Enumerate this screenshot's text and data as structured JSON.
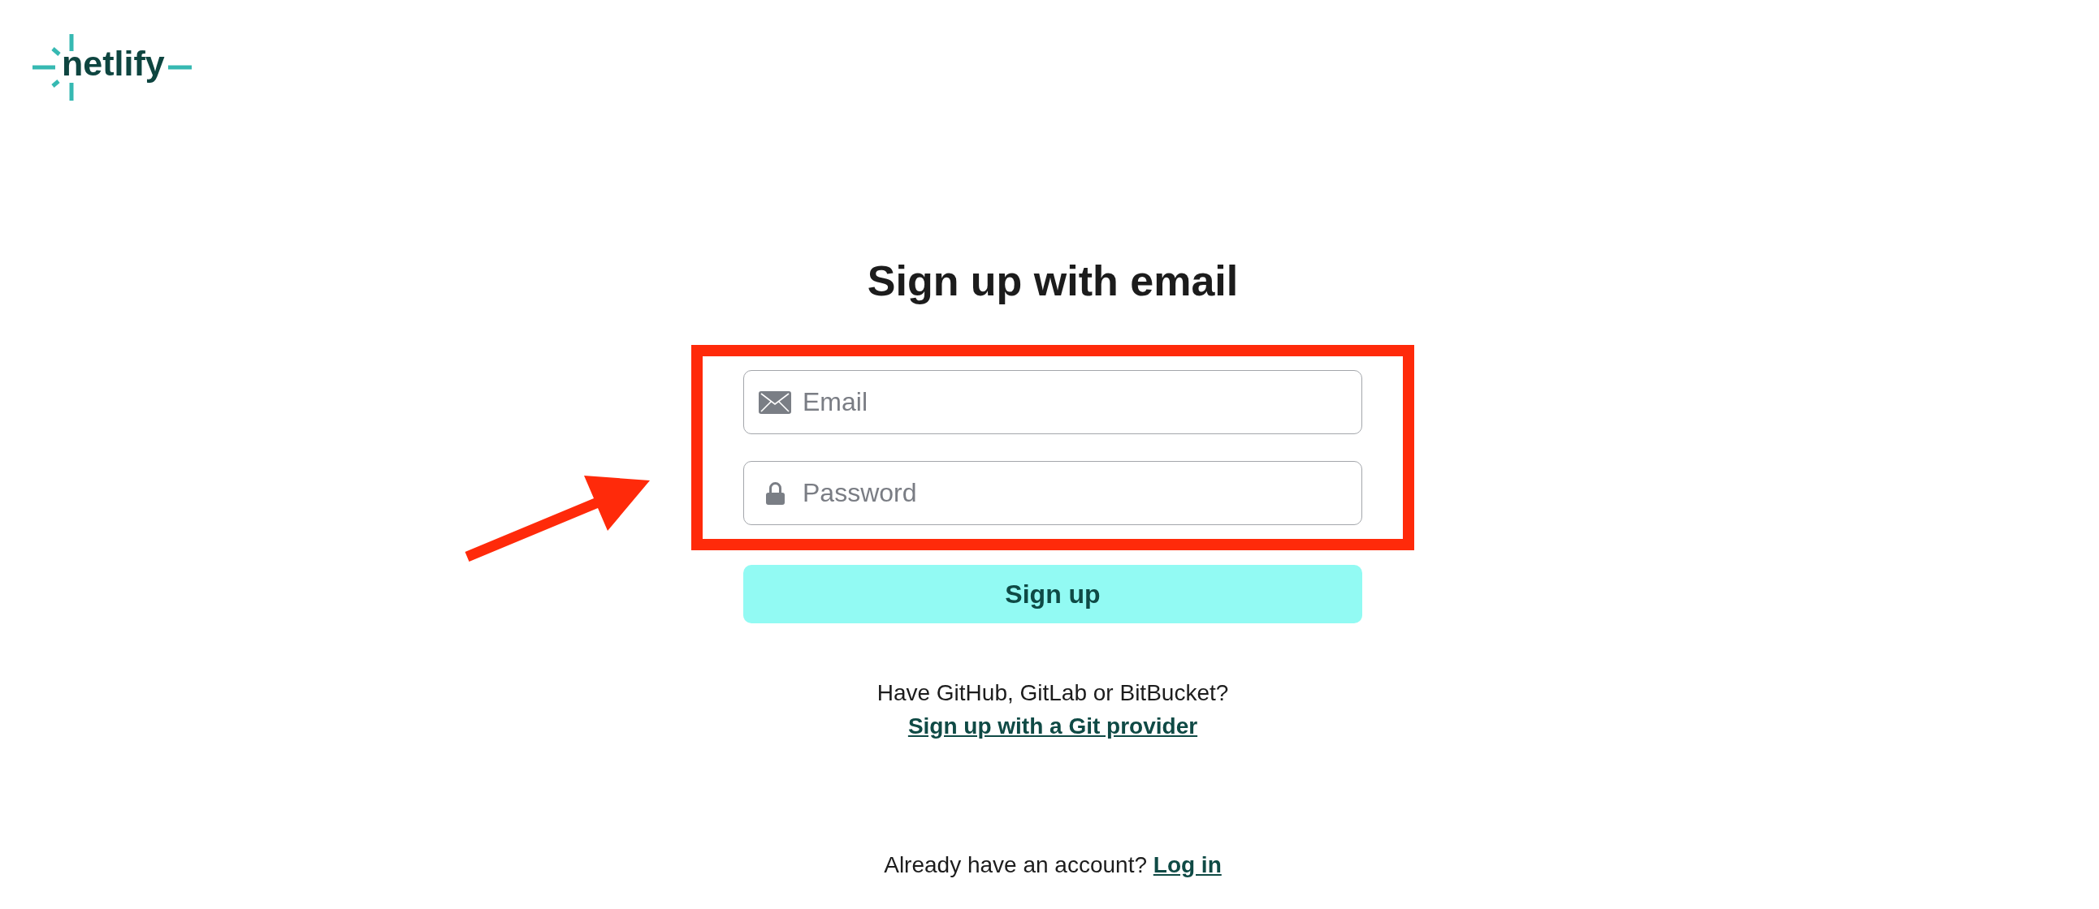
{
  "logo": {
    "text": "netlify"
  },
  "title": "Sign up with email",
  "fields": [
    {
      "kind": "email",
      "placeholder": "Email"
    },
    {
      "kind": "password",
      "placeholder": "Password"
    }
  ],
  "submit_button": {
    "label": "Sign up"
  },
  "git_provider": {
    "prompt": "Have GitHub, GitLab or BitBucket?",
    "link": "Sign up with a Git provider"
  },
  "login_prompt": {
    "text": "Already have an account?",
    "link": "Log in"
  },
  "annotations": {
    "frame_around_fields": true,
    "arrow": true
  }
}
